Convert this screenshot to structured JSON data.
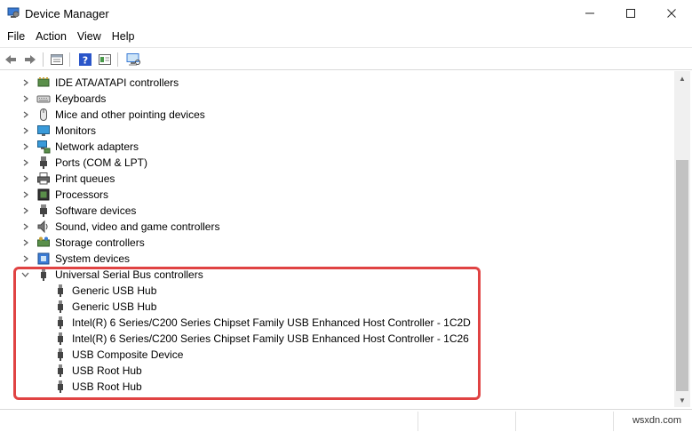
{
  "window": {
    "title": "Device Manager",
    "minimize_glyph": "—",
    "maximize_glyph": "☐",
    "close_glyph": "✕"
  },
  "menu": [
    "File",
    "Action",
    "View",
    "Help"
  ],
  "toolbar": {
    "buttons": [
      "back-icon",
      "forward-icon",
      "properties-icon",
      "help-icon",
      "update-driver-icon",
      "scan-hardware-icon"
    ]
  },
  "tree": {
    "categories": [
      {
        "label": "IDE ATA/ATAPI controllers",
        "icon": "ide-controller-icon",
        "expanded": false
      },
      {
        "label": "Keyboards",
        "icon": "keyboard-icon",
        "expanded": false
      },
      {
        "label": "Mice and other pointing devices",
        "icon": "mouse-icon",
        "expanded": false
      },
      {
        "label": "Monitors",
        "icon": "monitor-icon",
        "expanded": false
      },
      {
        "label": "Network adapters",
        "icon": "network-adapter-icon",
        "expanded": false
      },
      {
        "label": "Ports (COM & LPT)",
        "icon": "port-icon",
        "expanded": false
      },
      {
        "label": "Print queues",
        "icon": "printer-icon",
        "expanded": false
      },
      {
        "label": "Processors",
        "icon": "processor-icon",
        "expanded": false
      },
      {
        "label": "Software devices",
        "icon": "software-device-icon",
        "expanded": false
      },
      {
        "label": "Sound, video and game controllers",
        "icon": "sound-icon",
        "expanded": false
      },
      {
        "label": "Storage controllers",
        "icon": "storage-controller-icon",
        "expanded": false
      },
      {
        "label": "System devices",
        "icon": "system-device-icon",
        "expanded": false
      },
      {
        "label": "Universal Serial Bus controllers",
        "icon": "usb-icon",
        "expanded": true
      }
    ],
    "usb_children": [
      "Generic USB Hub",
      "Generic USB Hub",
      "Intel(R) 6 Series/C200 Series Chipset Family USB Enhanced Host Controller - 1C2D",
      "Intel(R) 6 Series/C200 Series Chipset Family USB Enhanced Host Controller - 1C26",
      "USB Composite Device",
      "USB Root Hub",
      "USB Root Hub"
    ]
  },
  "colors": {
    "highlight": "#e04343",
    "scroll_thumb": "#c2c2c2"
  },
  "watermark": "wsxdn.com"
}
